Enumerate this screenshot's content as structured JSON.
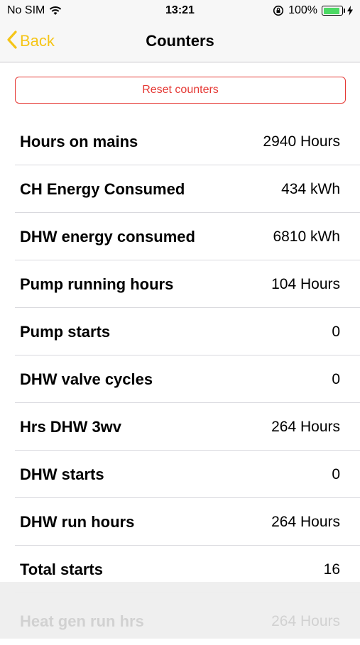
{
  "status_bar": {
    "carrier": "No SIM",
    "time": "13:21",
    "battery_percent": "100%",
    "battery_level": 1.0,
    "battery_color": "#4cd964"
  },
  "nav": {
    "back_label": "Back",
    "title": "Counters",
    "accent_color": "#f5c518"
  },
  "reset_button": {
    "label": "Reset counters",
    "color": "#e53935"
  },
  "counters": [
    {
      "label": "Hours on mains",
      "value": "2940 Hours"
    },
    {
      "label": "CH Energy Consumed",
      "value": "434 kWh"
    },
    {
      "label": "DHW energy consumed",
      "value": "6810 kWh"
    },
    {
      "label": "Pump running hours",
      "value": "104 Hours"
    },
    {
      "label": "Pump starts",
      "value": "0"
    },
    {
      "label": "DHW valve cycles",
      "value": "0"
    },
    {
      "label": "Hrs DHW 3wv",
      "value": "264 Hours"
    },
    {
      "label": "DHW starts",
      "value": "0"
    },
    {
      "label": "DHW run hours",
      "value": "264 Hours"
    },
    {
      "label": "Total starts",
      "value": "16"
    }
  ],
  "partial_row": {
    "label": "Heat gen run hrs",
    "value": "264 Hours"
  }
}
